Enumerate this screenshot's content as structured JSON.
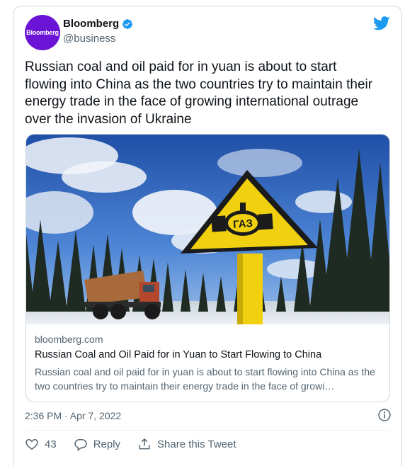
{
  "author": {
    "name": "Bloomberg",
    "handle": "@business",
    "avatar_text": "Bloomberg",
    "avatar_color": "#6b14d6",
    "verified_icon": "verified-badge-icon"
  },
  "tweet": {
    "text": "Russian coal and oil paid for in yuan is about to start flowing into China as the two countries try to maintain their energy trade in the face of growing international outrage over the invasion of Ukraine",
    "timestamp": "2:36 PM · Apr 7, 2022"
  },
  "link_card": {
    "domain": "bloomberg.com",
    "title": "Russian Coal and Oil Paid for in Yuan to Start Flowing to China",
    "description": "Russian coal and oil paid for in yuan is about to start flowing into China as the two countries try to maintain their energy trade in the face of growi…",
    "sign_text": "ГАЗ"
  },
  "actions": {
    "likes": "43",
    "reply_label": "Reply",
    "share_label": "Share this Tweet"
  },
  "colors": {
    "twitter_blue": "#1d9bf0",
    "secondary_text": "#536471",
    "border": "#cfd9de"
  }
}
